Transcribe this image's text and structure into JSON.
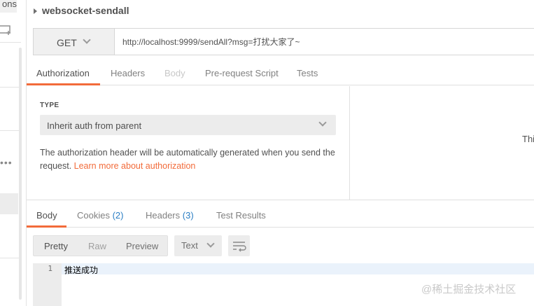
{
  "sidebar": {
    "tab_fragment": "ons",
    "more_label": "•••"
  },
  "request": {
    "name": "websocket-sendall",
    "method": "GET",
    "url": "http://localhost:9999/sendAll?msg=打扰大家了~"
  },
  "request_tabs": [
    "Authorization",
    "Headers",
    "Body",
    "Pre-request Script",
    "Tests"
  ],
  "auth": {
    "type_label": "TYPE",
    "type_value": "Inherit auth from parent",
    "description": "The authorization header will be automatically generated when you send the request.",
    "link_text": "Learn more about authorization",
    "right_panel_text": "Thi"
  },
  "response_tabs": {
    "body": "Body",
    "cookies": "Cookies",
    "cookies_count": "(2)",
    "headers": "Headers",
    "headers_count": "(3)",
    "test_results": "Test Results"
  },
  "response_toolbar": {
    "pretty": "Pretty",
    "raw": "Raw",
    "preview": "Preview",
    "format": "Text"
  },
  "response_body": {
    "line_number": "1",
    "content": "推送成功"
  },
  "watermark": "@稀土掘金技术社区",
  "colors": {
    "accent": "#f26b3a",
    "link_count": "#2a7ec4"
  }
}
